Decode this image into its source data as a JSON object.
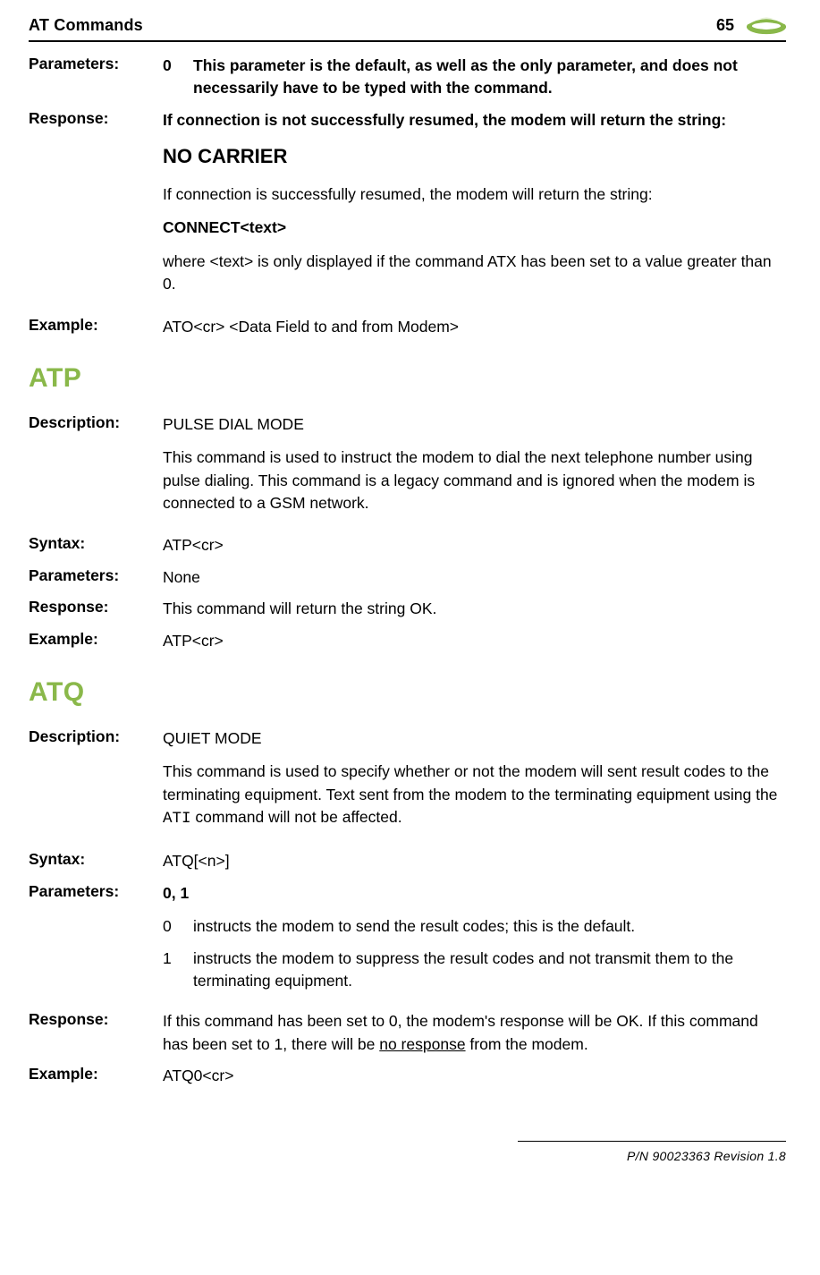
{
  "header": {
    "left": "AT Commands",
    "page_number": "65"
  },
  "ato_tail": {
    "parameters_label": "Parameters:",
    "param_num": "0",
    "param_text": "This parameter is the default, as well as the only parameter, and does not necessarily have to be typed with the command.",
    "response_label": "Response:",
    "response_intro": "If connection is not successfully resumed, the modem will return the string:",
    "no_carrier": "NO CARRIER",
    "response_success": "If connection is successfully resumed, the modem will return the string:",
    "connect_text": "CONNECT<text>",
    "where_text": "where <text> is only displayed if the command ATX has been set to a value greater than 0.",
    "example_label": "Example:",
    "example_value": "ATO<cr> <Data Field to and from Modem>"
  },
  "atp": {
    "title": "ATP",
    "description_label": "Description:",
    "description_title": "PULSE DIAL MODE",
    "description_body": "This command is used to instruct the modem to dial the next telephone number using pulse dialing. This command is a legacy command and is ignored when the modem is connected to a GSM network.",
    "syntax_label": "Syntax:",
    "syntax_value": "ATP<cr>",
    "parameters_label": "Parameters:",
    "parameters_value": "None",
    "response_label": "Response:",
    "response_value": "This command will return the string OK.",
    "example_label": "Example:",
    "example_value": "ATP<cr>"
  },
  "atq": {
    "title": "ATQ",
    "description_label": "Description:",
    "description_title": "QUIET MODE",
    "description_body_1": "This command is used to specify whether or not the modem will sent result codes to the terminating equipment. Text sent from the modem to the terminating equipment using the ",
    "description_body_mono": "ATI",
    "description_body_2": " command will not be affected.",
    "syntax_label": "Syntax:",
    "syntax_value": "ATQ[<n>]",
    "parameters_label": "Parameters:",
    "parameters_header": "0, 1",
    "param0_num": "0",
    "param0_text": "instructs the modem to send the result codes; this is the default.",
    "param1_num": "1",
    "param1_text": "instructs the modem to suppress the result codes and not transmit them to the terminating equipment.",
    "response_label": "Response:",
    "response_value_1": "If this command has been set to 0, the modem's response will be OK. If this command has been set to 1, there will be ",
    "response_value_underline": "no response",
    "response_value_2": " from the modem.",
    "example_label": "Example:",
    "example_value": "ATQ0<cr>"
  },
  "footer": {
    "text": "P/N 90023363  Revision 1.8"
  }
}
